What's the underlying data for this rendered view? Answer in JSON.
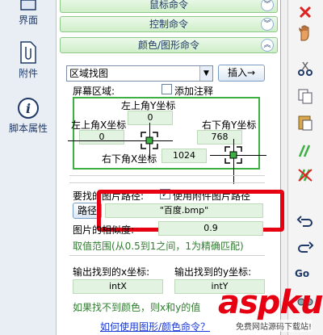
{
  "sidebar": {
    "items": [
      {
        "label": "界面",
        "icon": "window-icon"
      },
      {
        "label": "附件",
        "icon": "attachment-icon"
      },
      {
        "label": "脚本属性",
        "icon": "info-icon"
      }
    ]
  },
  "sections": {
    "mouse": "鼠标命令",
    "control": "控制命令",
    "color": "颜色/图形命令"
  },
  "find": {
    "mode": "区域找图",
    "insert_label": "插入→",
    "screen_area_label": "屏幕区域:",
    "add_comment_label": "添加注释",
    "top_left_y_label": "左上角Y坐标",
    "top_left_y": "0",
    "top_left_x_label": "左上角X坐标",
    "top_left_x": "0",
    "bottom_right_y_label": "右下角Y坐标",
    "bottom_right_y": "768",
    "bottom_right_x_label": "右下角X坐标",
    "bottom_right_x": "1024",
    "image_path_label": "要找的图片路径:",
    "use_attachment_label": "使用附件图片路径",
    "path_button": "路径",
    "image_path": "\"百度.bmp\"",
    "similarity_label": "图片的相似度:",
    "similarity": "0.9",
    "range_hint": "取值范围(从0.5到1之间，1为精确匹配)",
    "out_x_label": "输出找到的x坐标:",
    "out_x": "intX",
    "out_y_label": "输出找到的y坐标:",
    "out_y": "intY",
    "not_found_hint": "如果找不到颜色，则x和y的值",
    "help_link": "如何使用图形/颜色命令？"
  },
  "toolbar": {
    "go_label": "Go"
  },
  "watermark": {
    "brand": "aspku",
    "sub": "免费网站源码下载站!"
  },
  "colors": {
    "accent_green": "#3cb043",
    "red_highlight": "#e60012",
    "link_blue": "#1a39d6"
  }
}
